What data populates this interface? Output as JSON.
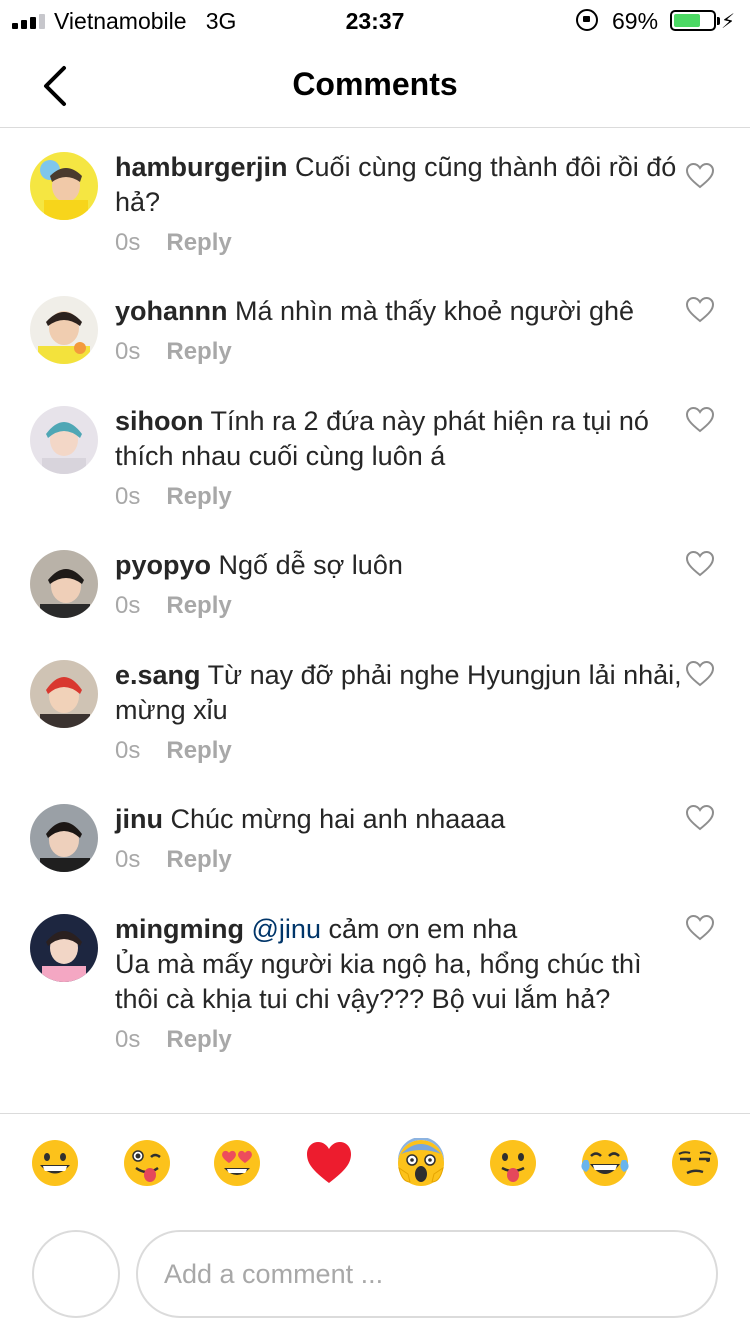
{
  "status_bar": {
    "carrier": "Vietnamobile",
    "network": "3G",
    "time": "23:37",
    "battery_percent": "69%",
    "battery_level": 0.69,
    "signal_bars_filled": 3,
    "signal_bars_total": 4
  },
  "header": {
    "title": "Comments",
    "back_icon": "chevron-left-icon"
  },
  "colors": {
    "text": "#262626",
    "meta": "#a8a8a8",
    "mention": "#003569",
    "divider": "#dbdbdb",
    "battery": "#4cd964"
  },
  "comments": [
    {
      "username": "hamburgerjin",
      "mention": "",
      "text": "Cuối cùng cũng thành đôi rồi đó hả?",
      "time": "0s",
      "reply_label": "Reply"
    },
    {
      "username": "yohannn",
      "mention": "",
      "text": "Má nhìn mà thấy khoẻ người ghê",
      "time": "0s",
      "reply_label": "Reply"
    },
    {
      "username": "sihoon",
      "mention": "",
      "text": "Tính ra 2 đứa này phát hiện ra tụi nó thích nhau cuối cùng luôn á",
      "time": "0s",
      "reply_label": "Reply"
    },
    {
      "username": "pyopyo",
      "mention": "",
      "text": "Ngố dễ sợ luôn",
      "time": "0s",
      "reply_label": "Reply"
    },
    {
      "username": "e.sang",
      "mention": "",
      "text": "Từ nay đỡ phải nghe Hyungjun lải nhải, mừng xỉu",
      "time": "0s",
      "reply_label": "Reply"
    },
    {
      "username": "jinu",
      "mention": "",
      "text": "Chúc mừng hai anh nhaaaa",
      "time": "0s",
      "reply_label": "Reply"
    },
    {
      "username": "mingming",
      "mention": "@jinu",
      "text": "cảm ơn em nha",
      "text2": "Ủa mà mấy người kia ngộ ha, hổng chúc thì thôi cà khịa tui chi vậy??? Bộ vui lắm hả?",
      "time": "0s",
      "reply_label": "Reply"
    }
  ],
  "emoji_bar": [
    {
      "name": "grinning-face-emoji"
    },
    {
      "name": "winking-tongue-face-emoji"
    },
    {
      "name": "heart-eyes-face-emoji"
    },
    {
      "name": "red-heart-emoji"
    },
    {
      "name": "screaming-face-emoji"
    },
    {
      "name": "tongue-out-face-emoji"
    },
    {
      "name": "tears-of-joy-face-emoji"
    },
    {
      "name": "unamused-face-emoji"
    }
  ],
  "composer": {
    "placeholder": "Add a comment ..."
  }
}
